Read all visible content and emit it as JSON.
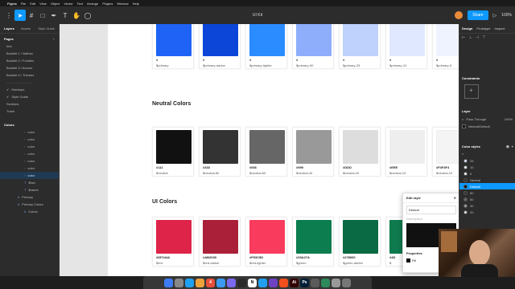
{
  "menubar": {
    "app": "Figma",
    "items": [
      "File",
      "Edit",
      "View",
      "Object",
      "Vector",
      "Text",
      "Arrange",
      "Plugins",
      "Window",
      "Help"
    ],
    "time": "Thu Mar 4  12:29 PM"
  },
  "toolbar": {
    "filename": "UI Kit",
    "share": "Share",
    "zoom": "100%"
  },
  "left_panel": {
    "tabs": [
      "Layers",
      "Assets"
    ],
    "active_tab": "Layers",
    "style_guide": "Style Guide",
    "pages_title": "Pages",
    "pages": [
      {
        "label": "Info",
        "check": false
      },
      {
        "label": "Booklet 1 / Nathan",
        "check": false
      },
      {
        "label": "Booklet 2 / Foodies",
        "check": false
      },
      {
        "label": "Booklet 3 / Acorns",
        "check": false
      },
      {
        "label": "Booklet 4 / Themes",
        "check": false
      },
      {
        "label": "————————",
        "check": false
      },
      {
        "label": "Mockups",
        "check": true
      },
      {
        "label": "Style Guide",
        "check": true
      },
      {
        "label": "Sections",
        "check": false
      },
      {
        "label": "Trash",
        "check": false
      }
    ],
    "layers_title": "Colors",
    "layers": [
      {
        "label": "color",
        "sel": false
      },
      {
        "label": "color",
        "sel": false
      },
      {
        "label": "color",
        "sel": false
      },
      {
        "label": "color",
        "sel": false
      },
      {
        "label": "color",
        "sel": false
      },
      {
        "label": "color",
        "sel": false
      },
      {
        "label": "color",
        "sel": true
      },
      {
        "label": "$hex",
        "sel": false
      },
      {
        "label": "$name",
        "sel": false
      },
      {
        "label": "Primary",
        "sel": false
      },
      {
        "label": "Primary Colors",
        "sel": false
      },
      {
        "label": "Colors",
        "sel": false
      }
    ]
  },
  "canvas": {
    "groups": [
      {
        "title": "",
        "swatches": [
          {
            "hex": "#",
            "name": "$primary",
            "color": "#1e63f5"
          },
          {
            "hex": "#",
            "name": "$primary-darker",
            "color": "#0b46d9"
          },
          {
            "hex": "#",
            "name": "$primary-lighter",
            "color": "#2b8cff"
          },
          {
            "hex": "#",
            "name": "$primary-50",
            "color": "#8eaefc"
          },
          {
            "hex": "#",
            "name": "$primary-25",
            "color": "#bfd1fd"
          },
          {
            "hex": "#",
            "name": "$primary-10",
            "color": "#dfe8fe"
          },
          {
            "hex": "#",
            "name": "$primary-5",
            "color": "#eef3ff"
          }
        ]
      },
      {
        "title": "Neutral Colors",
        "swatches": [
          {
            "hex": "#111",
            "name": "$neutral",
            "color": "#111111"
          },
          {
            "hex": "#333",
            "name": "$neutral-80",
            "color": "#333333"
          },
          {
            "hex": "#666",
            "name": "$neutral-60",
            "color": "#666666"
          },
          {
            "hex": "#999",
            "name": "$neutral-40",
            "color": "#999999"
          },
          {
            "hex": "#DDD",
            "name": "$neutral-20",
            "color": "#dddddd"
          },
          {
            "hex": "#EEE",
            "name": "$neutral-15",
            "color": "#eeeeee"
          },
          {
            "hex": "#F4F4F4",
            "name": "$neutral-10",
            "color": "#f4f4f4"
          }
        ]
      },
      {
        "title": "UI Colors",
        "swatches": [
          {
            "hex": "#DF244A",
            "name": "$red",
            "color": "#df244a"
          },
          {
            "hex": "#AB2039",
            "name": "$red-darker",
            "color": "#ab2039"
          },
          {
            "hex": "#F93C5D",
            "name": "$red-lighter",
            "color": "#f93c5d"
          },
          {
            "hex": "#33A27A",
            "name": "$green",
            "color": "#0c7d4f"
          },
          {
            "hex": "#278060",
            "name": "$green-darker",
            "color": "#0a6a43"
          },
          {
            "hex": "#4D",
            "name": "$",
            "color": "#0f7a4d"
          }
        ]
      }
    ]
  },
  "popup": {
    "title": "Edit style",
    "name_value": "Default",
    "description_placeholder": "Description",
    "properties": "Properties",
    "fill_label": "Fill",
    "fill_pct": "100%"
  },
  "right_panel": {
    "tabs": [
      "Design",
      "Prototype",
      "Inspect"
    ],
    "active_tab": "Design",
    "constraints": "Constraints",
    "layer_title": "Layer",
    "pass_through": "Pass Through",
    "layer_pct": "100%",
    "fill_style": "Neutral/Default",
    "color_styles": "Color styles",
    "style_rows": [
      {
        "label": "25",
        "sel": false,
        "color": "#dfe8fe"
      },
      {
        "label": "10",
        "sel": false,
        "color": "#eef3ff"
      },
      {
        "label": "5",
        "sel": false,
        "color": "#f7f9ff"
      },
      {
        "label": "Neutral",
        "sel": false,
        "color": "#2c2c2c"
      },
      {
        "label": "Default",
        "sel": true,
        "color": "#111111"
      },
      {
        "label": "80",
        "sel": false,
        "color": "#333333"
      },
      {
        "label": "60",
        "sel": false,
        "color": "#666666"
      },
      {
        "label": "40",
        "sel": false,
        "color": "#999999"
      },
      {
        "label": "20",
        "sel": false,
        "color": "#dddddd"
      }
    ]
  },
  "dock": {
    "apps": [
      {
        "label": "",
        "color": "#3d7cf5"
      },
      {
        "label": "",
        "color": "#888888"
      },
      {
        "label": "",
        "color": "#1fa1f2"
      },
      {
        "label": "",
        "color": "#f0a23a"
      },
      {
        "label": "4",
        "color": "#e94f3b"
      },
      {
        "label": "",
        "color": "#3c9bf0"
      },
      {
        "label": "",
        "color": "#7a6af0"
      },
      {
        "label": "",
        "color": "#2a2a2a"
      },
      {
        "label": "N",
        "color": "#ffffff"
      },
      {
        "label": "",
        "color": "#21a0f0"
      },
      {
        "label": "",
        "color": "#6f42c1"
      },
      {
        "label": "",
        "color": "#f24e1e"
      },
      {
        "label": "Ai",
        "color": "#330000"
      },
      {
        "label": "Ps",
        "color": "#001e36"
      },
      {
        "label": "",
        "color": "#5b5b5b"
      },
      {
        "label": "",
        "color": "#2d8a5a"
      },
      {
        "label": "",
        "color": "#999999"
      },
      {
        "label": "",
        "color": "#777777"
      }
    ]
  }
}
